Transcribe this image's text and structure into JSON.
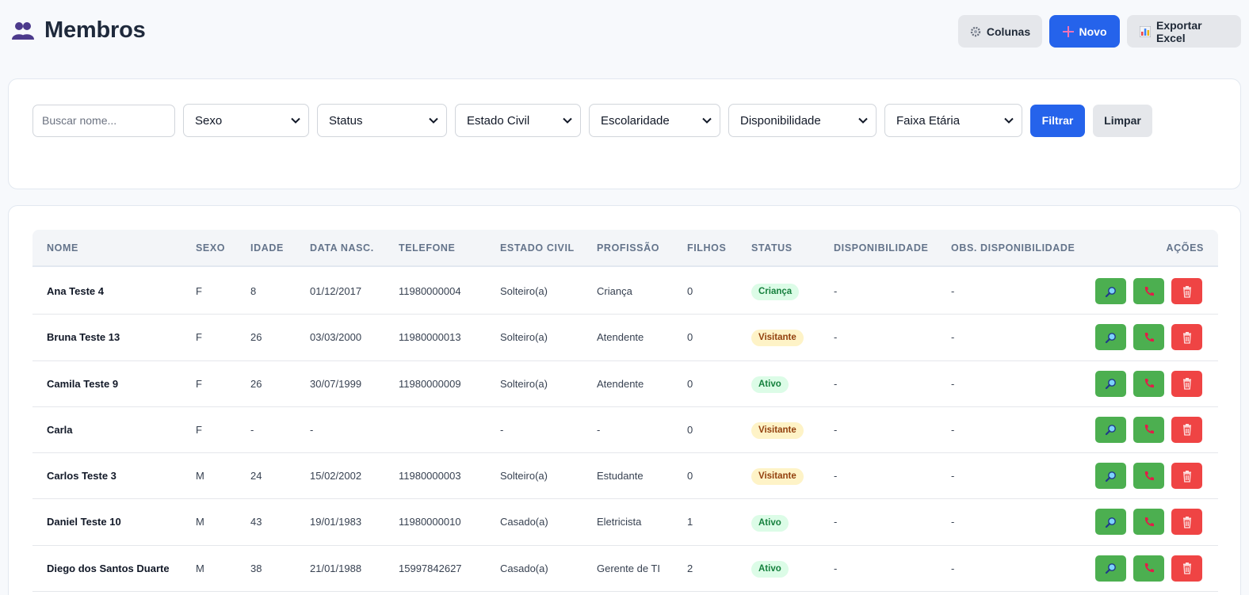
{
  "header": {
    "title": "Membros",
    "title_icon": "people-icon",
    "columns_label": "Colunas",
    "new_label": "Novo",
    "export_label": "Exportar Excel"
  },
  "filters": {
    "search_placeholder": "Buscar nome...",
    "sexo": "Sexo",
    "status": "Status",
    "estado_civil": "Estado Civil",
    "escolaridade": "Escolaridade",
    "disponibilidade": "Disponibilidade",
    "faixa_etaria": "Faixa Etária",
    "filter_label": "Filtrar",
    "clear_label": "Limpar"
  },
  "table": {
    "columns": [
      "NOME",
      "SEXO",
      "IDADE",
      "DATA NASC.",
      "TELEFONE",
      "ESTADO CIVIL",
      "PROFISSÃO",
      "FILHOS",
      "STATUS",
      "DISPONIBILIDADE",
      "OBS. DISPONIBILIDADE",
      "AÇÕES"
    ],
    "rows": [
      {
        "nome": "Ana Teste 4",
        "sexo": "F",
        "idade": "8",
        "nasc": "01/12/2017",
        "telefone": "11980000004",
        "civil": "Solteiro(a)",
        "profissao": "Criança",
        "filhos": "0",
        "status": "Criança",
        "disp": "-",
        "obs": "-"
      },
      {
        "nome": "Bruna Teste 13",
        "sexo": "F",
        "idade": "26",
        "nasc": "03/03/2000",
        "telefone": "11980000013",
        "civil": "Solteiro(a)",
        "profissao": "Atendente",
        "filhos": "0",
        "status": "Visitante",
        "disp": "-",
        "obs": "-"
      },
      {
        "nome": "Camila Teste 9",
        "sexo": "F",
        "idade": "26",
        "nasc": "30/07/1999",
        "telefone": "11980000009",
        "civil": "Solteiro(a)",
        "profissao": "Atendente",
        "filhos": "0",
        "status": "Ativo",
        "disp": "-",
        "obs": "-"
      },
      {
        "nome": "Carla",
        "sexo": "F",
        "idade": "-",
        "nasc": "-",
        "telefone": "",
        "civil": "-",
        "profissao": "-",
        "filhos": "0",
        "status": "Visitante",
        "disp": "-",
        "obs": "-"
      },
      {
        "nome": "Carlos Teste 3",
        "sexo": "M",
        "idade": "24",
        "nasc": "15/02/2002",
        "telefone": "11980000003",
        "civil": "Solteiro(a)",
        "profissao": "Estudante",
        "filhos": "0",
        "status": "Visitante",
        "disp": "-",
        "obs": "-"
      },
      {
        "nome": "Daniel Teste 10",
        "sexo": "M",
        "idade": "43",
        "nasc": "19/01/1983",
        "telefone": "11980000010",
        "civil": "Casado(a)",
        "profissao": "Eletricista",
        "filhos": "1",
        "status": "Ativo",
        "disp": "-",
        "obs": "-"
      },
      {
        "nome": "Diego dos Santos Duarte",
        "sexo": "M",
        "idade": "38",
        "nasc": "21/01/1988",
        "telefone": "15997842627",
        "civil": "Casado(a)",
        "profissao": "Gerente de TI",
        "filhos": "2",
        "status": "Ativo",
        "disp": "-",
        "obs": "-"
      }
    ],
    "row_action_icons": [
      "search-icon",
      "phone-icon",
      "trash-icon"
    ]
  },
  "colors": {
    "primary": "#2563eb",
    "action_green": "#4caf50",
    "action_red": "#ef4444",
    "badge_green_bg": "#dcfce7",
    "badge_yellow_bg": "#fef3c7"
  }
}
